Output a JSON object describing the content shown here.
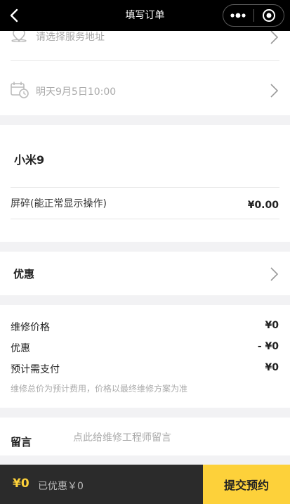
{
  "nav": {
    "title": "填写订单"
  },
  "address": {
    "placeholder": "请选择服务地址"
  },
  "time": {
    "value": "明天9月5日10:00"
  },
  "device": {
    "model": "小米9"
  },
  "fault": {
    "label": "屏碎(能正常显示操作)",
    "price": "¥0.00"
  },
  "discount": {
    "label": "优惠"
  },
  "summary": {
    "repair_price_label": "维修价格",
    "repair_price": "¥0",
    "discount_label": "优惠",
    "discount": "- ¥0",
    "pay_label": "预计需支付",
    "pay": "¥0",
    "note": "维修总价为预计费用，价格以最终维修方案为准"
  },
  "message": {
    "label": "留言",
    "placeholder": "点此给维修工程师留言"
  },
  "footer": {
    "total": "¥0",
    "discounted": "已优惠￥0",
    "submit": "提交预约"
  },
  "colors": {
    "accent": "#fdd13a",
    "nav_bg": "#000000",
    "footer_bg": "#2b2b2b"
  }
}
